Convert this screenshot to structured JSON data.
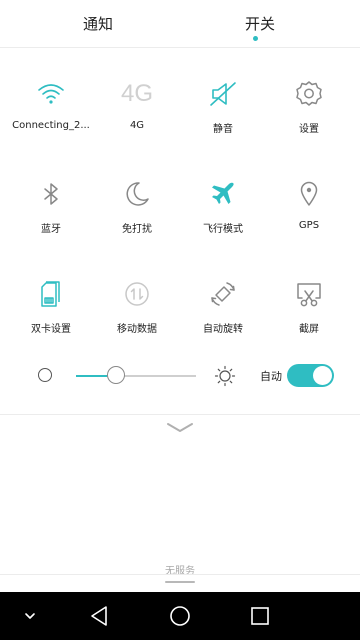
{
  "tabs": {
    "notify": "通知",
    "switch": "开关"
  },
  "tiles": [
    {
      "label": "Connecting_2...",
      "icon": "wifi-icon",
      "active": true
    },
    {
      "label": "4G",
      "icon": "4g-icon",
      "icon_text": "4G",
      "active": false
    },
    {
      "label": "静音",
      "icon": "mute-icon",
      "active": true
    },
    {
      "label": "设置",
      "icon": "settings-gear-icon",
      "active": false
    },
    {
      "label": "蓝牙",
      "icon": "bluetooth-icon",
      "active": false
    },
    {
      "label": "免打扰",
      "icon": "moon-icon",
      "active": false
    },
    {
      "label": "飞行模式",
      "icon": "airplane-icon",
      "active": true
    },
    {
      "label": "GPS",
      "icon": "location-pin-icon",
      "active": false
    },
    {
      "label": "双卡设置",
      "icon": "dual-sim-icon",
      "active": true
    },
    {
      "label": "移动数据",
      "icon": "mobile-data-icon",
      "active": false
    },
    {
      "label": "自动旋转",
      "icon": "auto-rotate-icon",
      "active": false
    },
    {
      "label": "截屏",
      "icon": "screenshot-icon",
      "active": false
    }
  ],
  "brightness": {
    "level": 0.33,
    "auto_label": "自动",
    "auto_on": true
  },
  "status_text": "无服务",
  "colors": {
    "accent": "#2fbdc2",
    "inactive": "#888888",
    "nav_bg": "#000000"
  },
  "navbar": [
    "chevron-down-icon",
    "back-icon",
    "home-icon",
    "recents-icon"
  ]
}
